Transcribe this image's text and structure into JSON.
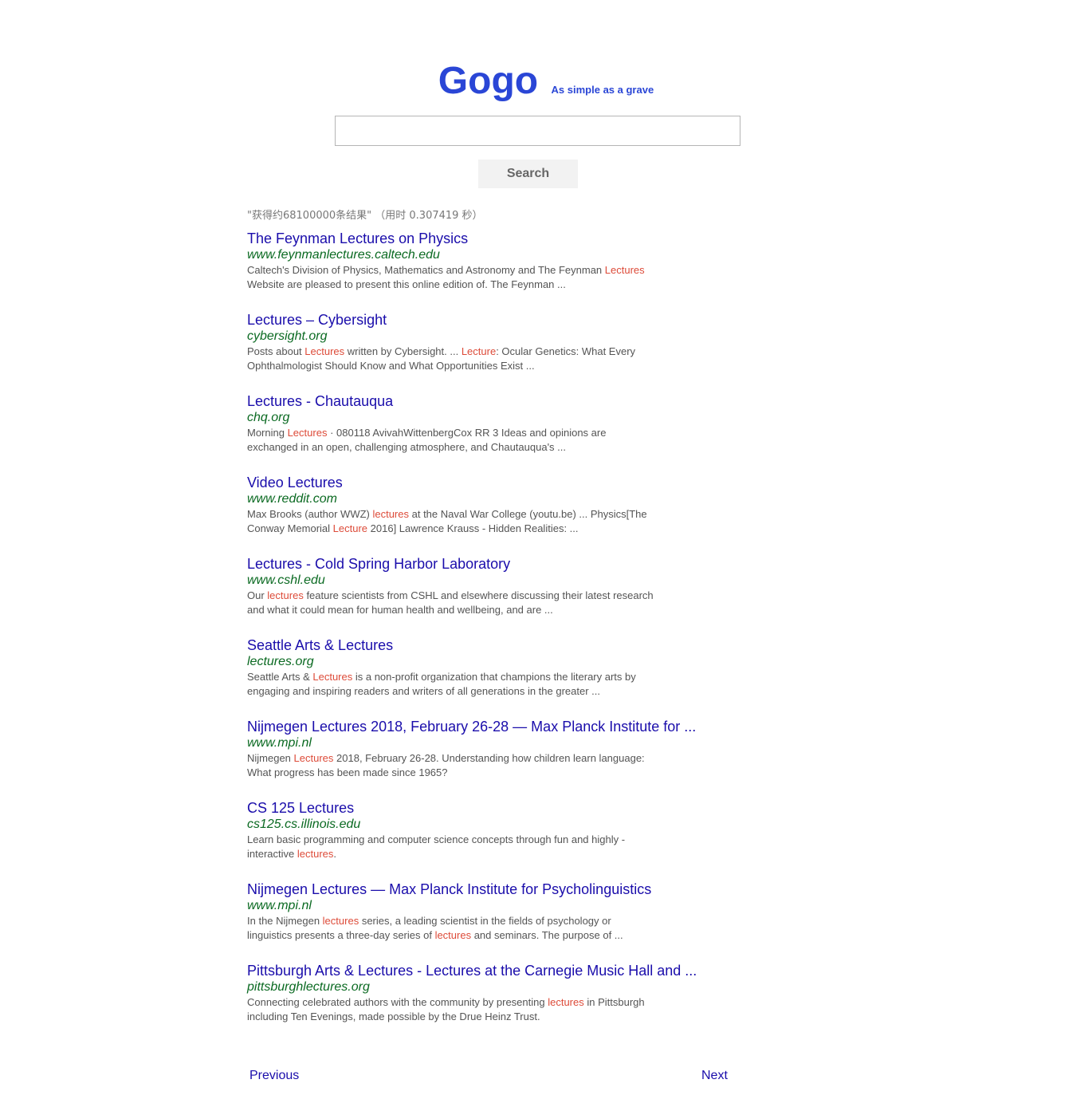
{
  "header": {
    "logo": "Gogo",
    "tagline": "As simple as a grave"
  },
  "search": {
    "value": "",
    "placeholder": "",
    "button_label": "Search"
  },
  "stats": "\"获得约68100000条结果\" （用时 0.307419 秒）",
  "results": [
    {
      "title": "The Feynman Lectures on Physics",
      "url": "www.feynmanlectures.caltech.edu",
      "snippet": [
        {
          "text": "Caltech's Division of Physics, Mathematics and Astronomy and The Feynman ",
          "hl": false
        },
        {
          "text": "Lectures",
          "hl": true
        },
        {
          "text": " Website are pleased to present this online edition of. The Feynman ...",
          "hl": false
        }
      ]
    },
    {
      "title": "Lectures – Cybersight",
      "url": "cybersight.org",
      "snippet": [
        {
          "text": "Posts about ",
          "hl": false
        },
        {
          "text": "Lectures",
          "hl": true
        },
        {
          "text": " written by Cybersight. ... ",
          "hl": false
        },
        {
          "text": "Lecture",
          "hl": true
        },
        {
          "text": ": Ocular Genetics: What Every Ophthalmologist Should Know and What Opportunities Exist ...",
          "hl": false
        }
      ]
    },
    {
      "title": "Lectures - Chautauqua",
      "url": "chq.org",
      "snippet": [
        {
          "text": "Morning ",
          "hl": false
        },
        {
          "text": "Lectures",
          "hl": true
        },
        {
          "text": " · 080118 AvivahWittenbergCox RR 3 Ideas and opinions are exchanged in an open, challenging atmosphere, and Chautauqua's ...",
          "hl": false
        }
      ]
    },
    {
      "title": "Video Lectures",
      "url": "www.reddit.com",
      "snippet": [
        {
          "text": "Max Brooks (author WWZ) ",
          "hl": false
        },
        {
          "text": "lectures",
          "hl": true
        },
        {
          "text": " at the Naval War College (youtu.be) ... Physics[The Conway Memorial ",
          "hl": false
        },
        {
          "text": "Lecture",
          "hl": true
        },
        {
          "text": " 2016] Lawrence Krauss - Hidden Realities: ...",
          "hl": false
        }
      ]
    },
    {
      "title": "Lectures - Cold Spring Harbor Laboratory",
      "url": "www.cshl.edu",
      "snippet": [
        {
          "text": "Our ",
          "hl": false
        },
        {
          "text": "lectures",
          "hl": true
        },
        {
          "text": " feature scientists from CSHL and elsewhere discussing their latest research and what it could mean for human health and wellbeing, and are ...",
          "hl": false
        }
      ]
    },
    {
      "title": "Seattle Arts & Lectures",
      "url": "lectures.org",
      "snippet": [
        {
          "text": "Seattle Arts & ",
          "hl": false
        },
        {
          "text": "Lectures",
          "hl": true
        },
        {
          "text": " is a non-profit organization that champions the literary arts by engaging and inspiring readers and writers of all generations in the greater ...",
          "hl": false
        }
      ]
    },
    {
      "title": "Nijmegen Lectures 2018, February 26-28 — Max Planck Institute for ...",
      "url": "www.mpi.nl",
      "snippet": [
        {
          "text": "Nijmegen ",
          "hl": false
        },
        {
          "text": "Lectures",
          "hl": true
        },
        {
          "text": " 2018, February 26-28. Understanding how children learn language: What progress has been made since 1965?",
          "hl": false
        }
      ]
    },
    {
      "title": "CS 125 Lectures",
      "url": "cs125.cs.illinois.edu",
      "snippet": [
        {
          "text": "Learn basic programming and computer science concepts through fun and highly - interactive ",
          "hl": false
        },
        {
          "text": "lectures",
          "hl": true
        },
        {
          "text": ".",
          "hl": false
        }
      ]
    },
    {
      "title": "Nijmegen Lectures — Max Planck Institute for Psycholinguistics",
      "url": "www.mpi.nl",
      "snippet": [
        {
          "text": "In the Nijmegen ",
          "hl": false
        },
        {
          "text": "lectures",
          "hl": true
        },
        {
          "text": " series, a leading scientist in the fields of psychology or linguistics presents a three-day series of ",
          "hl": false
        },
        {
          "text": "lectures",
          "hl": true
        },
        {
          "text": " and seminars. The purpose of ...",
          "hl": false
        }
      ]
    },
    {
      "title": "Pittsburgh Arts & Lectures - Lectures at the Carnegie Music Hall and ...",
      "url": "pittsburghlectures.org",
      "snippet": [
        {
          "text": "Connecting celebrated authors with the community by presenting ",
          "hl": false
        },
        {
          "text": "lectures",
          "hl": true
        },
        {
          "text": " in Pittsburgh including Ten Evenings, made possible by the Drue Heinz Trust.",
          "hl": false
        }
      ]
    }
  ],
  "pager": {
    "previous": "Previous",
    "next": "Next"
  },
  "colors": {
    "logo": "#2a46d6",
    "title_link": "#1a0dab",
    "url": "#0b6a22",
    "snippet": "#545454",
    "highlight": "#dd4b39",
    "stats": "#777777"
  }
}
